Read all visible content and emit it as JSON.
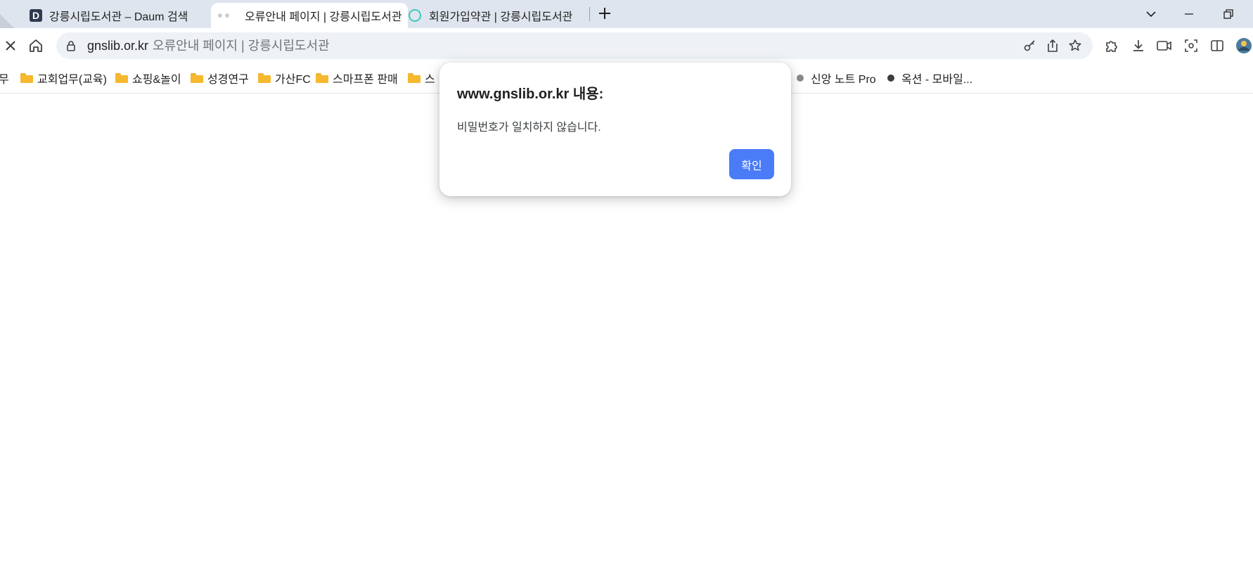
{
  "tabs": [
    {
      "title": "강릉시립도서관 – Daum 검색",
      "favicon": "daum-icon"
    },
    {
      "title": "오류안내 페이지 | 강릉시립도서관",
      "favicon": "loading-icon",
      "active": true
    },
    {
      "title": "회원가입약관 | 강릉시립도서관",
      "favicon": "ring-icon"
    }
  ],
  "omnibox": {
    "domain": "gnslib.or.kr",
    "page_title": "오류안내 페이지 | 강릉시립도서관"
  },
  "bookmarks": [
    {
      "label": "무",
      "type": "folder"
    },
    {
      "label": "교회업무(교육)",
      "type": "folder"
    },
    {
      "label": "쇼핑&놀이",
      "type": "folder"
    },
    {
      "label": "성경연구",
      "type": "folder"
    },
    {
      "label": "가산FC",
      "type": "folder"
    },
    {
      "label": "스마프폰 판매",
      "type": "folder"
    },
    {
      "label": "스",
      "type": "folder"
    },
    {
      "label": "신앙 노트 Pro",
      "type": "site"
    },
    {
      "label": "옥션 - 모바일...",
      "type": "site"
    }
  ],
  "dialog": {
    "title": "www.gnslib.or.kr 내용:",
    "message": "비밀번호가 일치하지 않습니다.",
    "ok_label": "확인"
  },
  "colors": {
    "tabstrip": "#dfe5ee",
    "omnibox": "#eef1f5",
    "dialog_button": "#4a7cf7",
    "folder": "#f5b82e"
  }
}
